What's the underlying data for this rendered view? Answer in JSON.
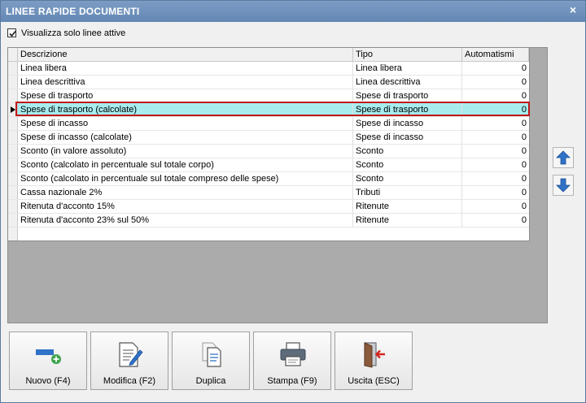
{
  "window": {
    "title": "LINEE RAPIDE DOCUMENTI",
    "close_glyph": "×"
  },
  "filter": {
    "label": "Visualizza solo linee attive",
    "checked": true
  },
  "grid": {
    "headers": {
      "descrizione": "Descrizione",
      "tipo": "Tipo",
      "automatismi": "Automatismi"
    },
    "selected_index": 3,
    "rows": [
      {
        "descrizione": "Linea libera",
        "tipo": "Linea libera",
        "automatismi": "0"
      },
      {
        "descrizione": "Linea descrittiva",
        "tipo": "Linea descrittiva",
        "automatismi": "0"
      },
      {
        "descrizione": "Spese di trasporto",
        "tipo": "Spese di trasporto",
        "automatismi": "0"
      },
      {
        "descrizione": "Spese di trasporto (calcolate)",
        "tipo": "Spese di trasporto",
        "automatismi": "0"
      },
      {
        "descrizione": "Spese di incasso",
        "tipo": "Spese di incasso",
        "automatismi": "0"
      },
      {
        "descrizione": "Spese di incasso (calcolate)",
        "tipo": "Spese di incasso",
        "automatismi": "0"
      },
      {
        "descrizione": "Sconto (in valore assoluto)",
        "tipo": "Sconto",
        "automatismi": "0"
      },
      {
        "descrizione": "Sconto (calcolato in percentuale sul totale corpo)",
        "tipo": "Sconto",
        "automatismi": "0"
      },
      {
        "descrizione": "Sconto (calcolato in percentuale sul totale compreso delle spese)",
        "tipo": "Sconto",
        "automatismi": "0"
      },
      {
        "descrizione": "Cassa nazionale 2%",
        "tipo": "Tributi",
        "automatismi": "0"
      },
      {
        "descrizione": "Ritenuta d'acconto 15%",
        "tipo": "Ritenute",
        "automatismi": "0"
      },
      {
        "descrizione": "Ritenuta d'acconto 23% sul 50%",
        "tipo": "Ritenute",
        "automatismi": "0"
      }
    ]
  },
  "side_buttons": {
    "up_icon": "arrow-up-icon",
    "down_icon": "arrow-down-icon"
  },
  "buttons": {
    "nuovo": "Nuovo (F4)",
    "modifica": "Modifica (F2)",
    "duplica": "Duplica",
    "stampa": "Stampa (F9)",
    "uscita": "Uscita (ESC)"
  },
  "colors": {
    "selection": "#a8ecee",
    "highlight_border": "#c0171b",
    "accent_blue": "#2f72c8"
  }
}
